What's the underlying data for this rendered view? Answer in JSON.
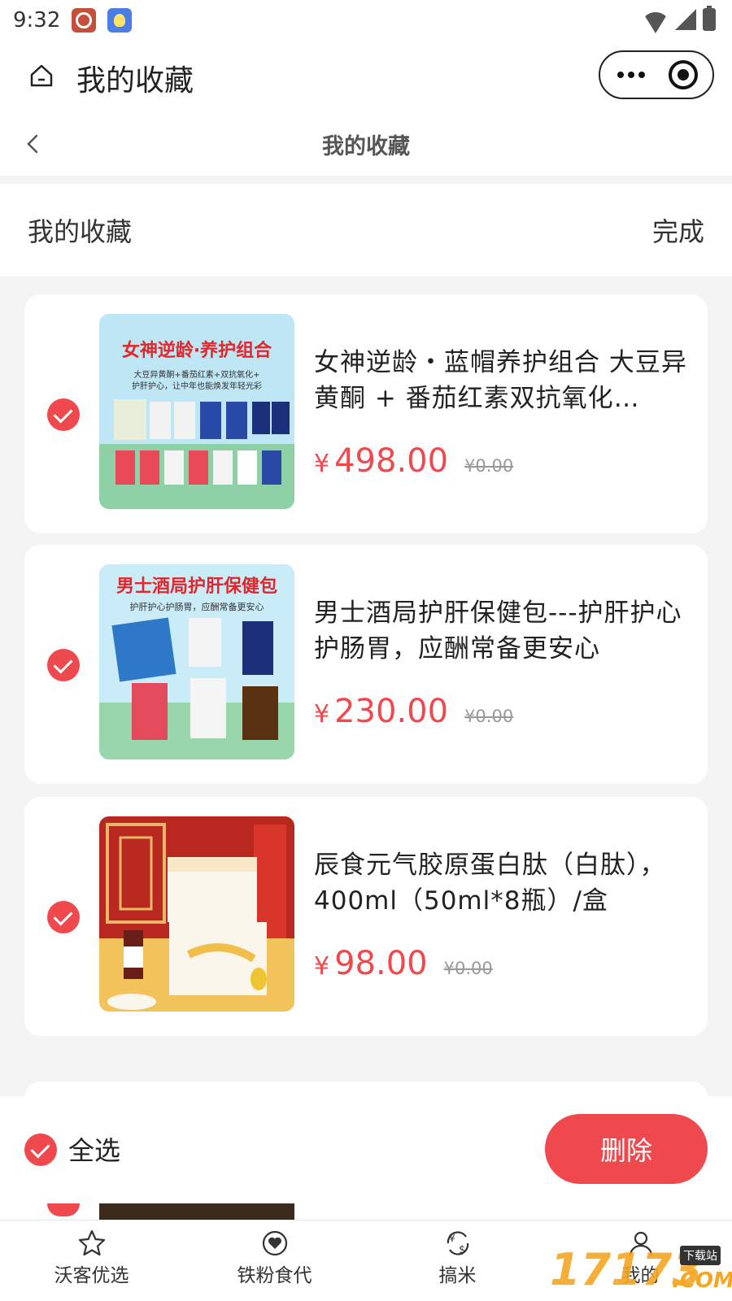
{
  "status": {
    "time": "9:32"
  },
  "mp_header": {
    "title": "我的收藏"
  },
  "page_nav": {
    "title": "我的收藏"
  },
  "section": {
    "title": "我的收藏",
    "done_label": "完成"
  },
  "items": [
    {
      "name": "女神逆龄・蓝帽养护组合 大豆异黄酮 + 番茄红素双抗氧化…",
      "price_symbol": "¥",
      "price": "498.00",
      "old_price": "¥0.00",
      "img_title": "女神逆龄·养护组合",
      "img_sub1": "大豆异黄酮+番茄红素+双抗氧化+",
      "img_sub2": "护肝护心，让中年也能焕发年轻光彩"
    },
    {
      "name": "男士酒局护肝保健包---护肝护心护肠胃，应酬常备更安心",
      "price_symbol": "¥",
      "price": "230.00",
      "old_price": "¥0.00",
      "img_title": "男士酒局护肝保健包",
      "img_sub1": "护肝护心护肠胃，应酬常备更安心"
    },
    {
      "name": "辰食元气胶原蛋白肽（白肽），400ml（50ml*8瓶）/盒",
      "price_symbol": "¥",
      "price": "98.00",
      "old_price": "¥0.00"
    }
  ],
  "action_bar": {
    "select_all_label": "全选",
    "delete_label": "删除"
  },
  "tabs": [
    {
      "label": "沃客优选",
      "icon": "star-icon"
    },
    {
      "label": "铁粉食代",
      "icon": "heart-circle-icon"
    },
    {
      "label": "搞米",
      "icon": "yuan-dollar-exchange-icon"
    },
    {
      "label": "我的",
      "icon": "person-icon"
    }
  ],
  "watermark": {
    "text": "17173",
    "badge": "下载站",
    "suffix": ".COM"
  },
  "colors": {
    "accent": "#f0494d",
    "background": "#f4f4f4"
  }
}
